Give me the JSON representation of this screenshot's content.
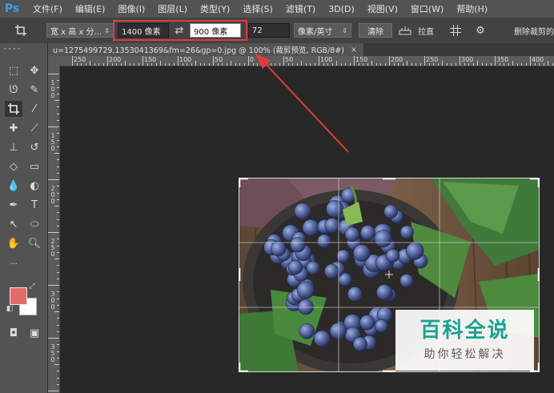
{
  "app": {
    "logo": "Ps"
  },
  "menubar": {
    "items": [
      "文件(F)",
      "编辑(E)",
      "图像(I)",
      "图层(L)",
      "类型(Y)",
      "选择(S)",
      "滤镜(T)",
      "3D(D)",
      "视图(V)",
      "窗口(W)",
      "帮助(H)"
    ]
  },
  "options": {
    "preset_select": "宽 x 高 x 分...",
    "width_value": "1400 像素",
    "swap_icon": "⇄",
    "height_value": "900 像素",
    "resolution_value": "72",
    "unit_select": "像素/英寸",
    "clear_button": "清除",
    "straighten_label": "拉直",
    "delete_cropped_label": "删除裁剪的"
  },
  "document": {
    "tab_title": "u=1275499729,1353041369&fm=26&gp=0.jpg @ 100% (裁剪预览, RGB/8#)",
    "close_glyph": "×"
  },
  "ruler": {
    "h_labels": [
      "250",
      "200",
      "150",
      "100",
      "50",
      "0",
      "50",
      "100",
      "150",
      "200",
      "250",
      "300",
      "350",
      "400"
    ],
    "v_labels": [
      "1",
      "0",
      "0",
      "1",
      "5",
      "0",
      "2",
      "0",
      "0",
      "2",
      "5",
      "0",
      "3",
      "0",
      "0",
      "3",
      "5",
      "0"
    ]
  },
  "watermark": {
    "title": "百科全说",
    "subtitle": "助你轻松解决"
  },
  "colors": {
    "foreground": "#e46b6d",
    "background": "#ffffff",
    "highlight": "#e33b3b"
  }
}
